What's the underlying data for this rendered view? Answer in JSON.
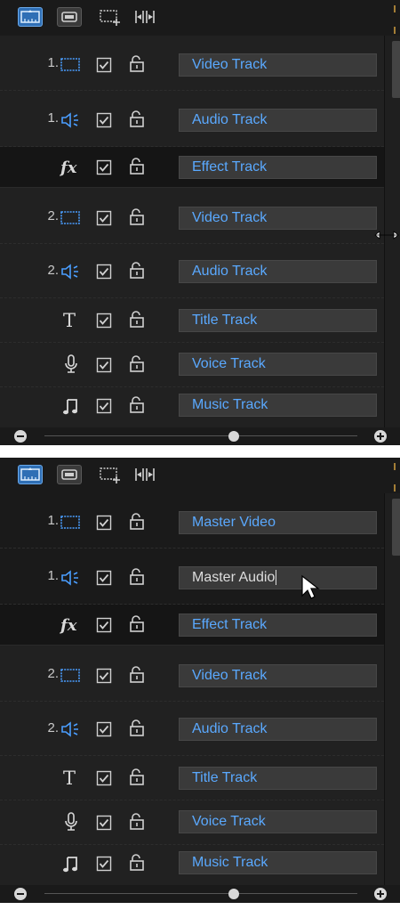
{
  "colors": {
    "panel_bg": "#1c1c1c",
    "track_label_text": "#5aa9ff",
    "track_icon_blue": "#4a9eff",
    "text_light": "#c9c9c9"
  },
  "panels": [
    {
      "id": "before-rename",
      "toolbar": {
        "icons": [
          "timeline-view-icon",
          "storyboard-view-icon",
          "track-manager-icon",
          "fit-timeline-icon"
        ]
      },
      "tracks": [
        {
          "number": "1.",
          "icon": "video-track-icon",
          "label": "Video Track",
          "enabled": true,
          "locked": false
        },
        {
          "number": "1.",
          "icon": "audio-track-icon",
          "label": "Audio Track",
          "enabled": true,
          "locked": false
        },
        {
          "number": "",
          "icon": "effect-fx-icon",
          "label": "Effect Track",
          "enabled": true,
          "locked": false
        },
        {
          "number": "2.",
          "icon": "video-track-icon",
          "label": "Video Track",
          "enabled": true,
          "locked": false
        },
        {
          "number": "2.",
          "icon": "audio-track-icon",
          "label": "Audio Track",
          "enabled": true,
          "locked": false
        },
        {
          "number": "",
          "icon": "title-t-icon",
          "label": "Title Track",
          "enabled": true,
          "locked": false
        },
        {
          "number": "",
          "icon": "microphone-icon",
          "label": "Voice Track",
          "enabled": true,
          "locked": false
        },
        {
          "number": "",
          "icon": "music-note-icon",
          "label": "Music Track",
          "enabled": true,
          "locked": false
        }
      ]
    },
    {
      "id": "after-rename",
      "toolbar": {
        "icons": [
          "timeline-view-icon",
          "storyboard-view-icon",
          "track-manager-icon",
          "fit-timeline-icon"
        ]
      },
      "tracks": [
        {
          "number": "1.",
          "icon": "video-track-icon",
          "label": "Master Video",
          "enabled": true,
          "locked": false
        },
        {
          "number": "1.",
          "icon": "audio-track-icon",
          "label": "Master Audio",
          "enabled": true,
          "locked": false,
          "editing": true
        },
        {
          "number": "",
          "icon": "effect-fx-icon",
          "label": "Effect Track",
          "enabled": true,
          "locked": false
        },
        {
          "number": "2.",
          "icon": "video-track-icon",
          "label": "Video Track",
          "enabled": true,
          "locked": false
        },
        {
          "number": "2.",
          "icon": "audio-track-icon",
          "label": "Audio Track",
          "enabled": true,
          "locked": false
        },
        {
          "number": "",
          "icon": "title-t-icon",
          "label": "Title Track",
          "enabled": true,
          "locked": false
        },
        {
          "number": "",
          "icon": "microphone-icon",
          "label": "Voice Track",
          "enabled": true,
          "locked": false
        },
        {
          "number": "",
          "icon": "music-note-icon",
          "label": "Music Track",
          "enabled": true,
          "locked": false
        }
      ]
    }
  ]
}
